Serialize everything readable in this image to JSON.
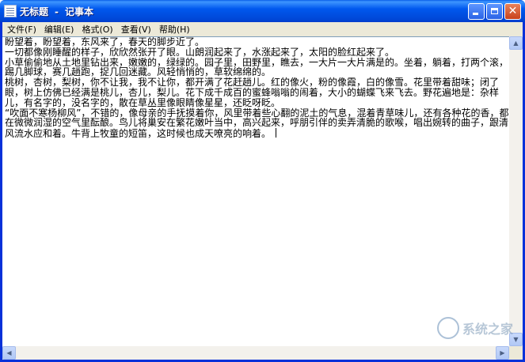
{
  "window": {
    "title": "无标题",
    "app_name": "记事本",
    "title_separator": "-",
    "accent_color": "#0058ee"
  },
  "menu": [
    {
      "label": "文件(F)"
    },
    {
      "label": "编辑(E)"
    },
    {
      "label": "格式(O)"
    },
    {
      "label": "查看(V)"
    },
    {
      "label": "帮助(H)"
    }
  ],
  "editor": {
    "content": "盼望着，盼望着，东风来了，春天的脚步近了。\n一切都像刚睡醒的样子，欣欣然张开了眼。山朗润起来了，水涨起来了，太阳的脸红起来了。\n小草偷偷地从土地里钻出来，嫩嫩的，绿绿的。园子里，田野里，瞧去，一大片一大片满是的。坐着，躺着，打两个滚，踢几脚球，赛几趟跑，捉几回迷藏。风轻悄悄的，草软绵绵的。\n桃树，杏树，梨树，你不让我，我不让你，都开满了花赶趟儿。红的像火，粉的像霞，白的像雪。花里带着甜味；闭了眼，树上仿佛已经满是桃儿，杏儿，梨儿。花下成千成百的蜜蜂嗡嗡的闹着，大小的蝴蝶飞来飞去。野花遍地是：杂样儿，有名字的，没名字的，散在草丛里像眼睛像星星，还眨呀眨。\n“吹面不寒杨柳风”，不错的，像母亲的手抚摸着你，风里带着些心翻的泥土的气息，混着青草味儿，还有各种花的香，都在微微润湿的空气里酝酿。鸟儿将巢安在繁花嫩叶当中，高兴起来，呼朋引伴的卖弄清脆的歌喉，唱出婉转的曲子，跟清风流水应和着。牛背上牧童的短笛，这时候也成天嘹亮的响着。"
  },
  "scrollbars": {
    "up_icon": "arrow-up-icon",
    "down_icon": "arrow-down-icon",
    "left_icon": "arrow-left-icon",
    "right_icon": "arrow-right-icon"
  },
  "watermark": {
    "text": "系统之家"
  }
}
